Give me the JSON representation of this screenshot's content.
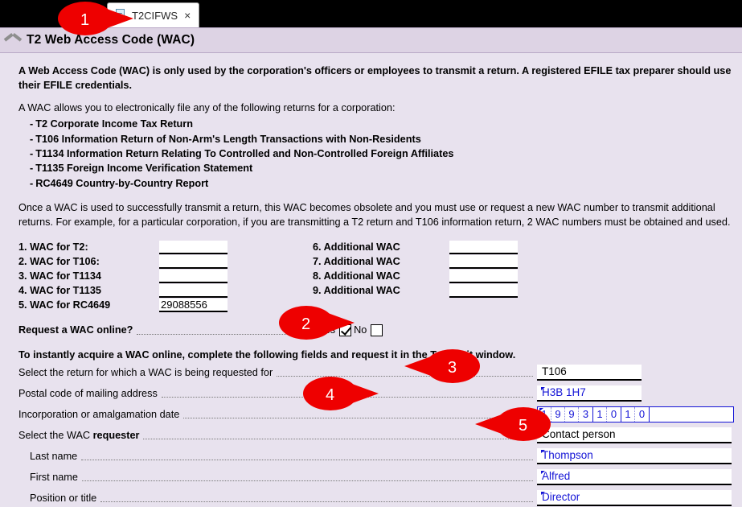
{
  "tab": {
    "label": "T2CIFWS",
    "close_label": "×",
    "doc_icon": "document-icon"
  },
  "form_header": {
    "collapse_icon": "chevron-up-icon",
    "title": "T2 Web Access Code (WAC)"
  },
  "intro": {
    "bold_paragraph": "A Web Access Code (WAC) is only used by the corporation's officers or employees to transmit a return. A registered EFILE tax preparer should use their EFILE credentials.",
    "list_lead": "A WAC allows you to electronically file any of the following returns for a corporation:",
    "returns": [
      "T2 Corporate Income Tax Return",
      "T106 Information Return of Non-Arm's Length Transactions with Non-Residents",
      "T1134 Information Return Relating To Controlled and Non-Controlled Foreign Affiliates",
      "T1135 Foreign Income Verification Statement",
      "RC4649 Country-by-Country Report"
    ],
    "note": "Once a WAC is used to successfully transmit a return, this WAC becomes obsolete and you must use or request a new WAC number to transmit additional returns. For example, for a particular corporation, if you are transmitting a T2 return and T106 information return, 2 WAC numbers must be obtained and used."
  },
  "wac_numbers": {
    "left": [
      {
        "label": "1. WAC for T2:",
        "value": ""
      },
      {
        "label": "2. WAC for T106:",
        "value": ""
      },
      {
        "label": "3. WAC for T1134",
        "value": ""
      },
      {
        "label": "4. WAC for T1135",
        "value": ""
      },
      {
        "label": "5. WAC for RC4649",
        "value": "29088556"
      }
    ],
    "right": [
      {
        "label": "6. Additional WAC",
        "value": ""
      },
      {
        "label": "7. Additional WAC",
        "value": ""
      },
      {
        "label": "8. Additional WAC",
        "value": ""
      },
      {
        "label": "9. Additional WAC",
        "value": ""
      }
    ]
  },
  "request_online": {
    "label": "Request a WAC online?",
    "yes_label": "Yes",
    "no_label": "No",
    "yes_checked": true,
    "no_checked": false
  },
  "instruction": "To instantly acquire a WAC online, complete the following fields and request it in the Transmit window.",
  "fields": {
    "return_select": {
      "label": "Select the return for which a WAC is being requested for",
      "value": "T106"
    },
    "postal_code": {
      "label": "Postal code of mailing address",
      "value": "H3B 1H7"
    },
    "incorporation_date": {
      "label": "Incorporation or amalgamation date",
      "groups": [
        [
          "1",
          "9",
          "9",
          "3"
        ],
        [
          "1",
          "0"
        ],
        [
          "1",
          "0"
        ]
      ]
    },
    "requester_select": {
      "label_prefix": "Select the WAC ",
      "label_bold": "requester",
      "value": "Contact person"
    },
    "last_name": {
      "label": "Last name",
      "value": "Thompson"
    },
    "first_name": {
      "label": "First name",
      "value": "Alfred"
    },
    "position": {
      "label": "Position or title",
      "value": "Director"
    }
  },
  "callouts": [
    {
      "number": "1",
      "direction": "right"
    },
    {
      "number": "2",
      "direction": "right"
    },
    {
      "number": "3",
      "direction": "left"
    },
    {
      "number": "4",
      "direction": "right"
    },
    {
      "number": "5",
      "direction": "left"
    }
  ],
  "colors": {
    "callout_red": "#ee0000",
    "background": "#e8e2ee",
    "header_band": "#ddd3e4",
    "field_blue": "#1414d6"
  }
}
